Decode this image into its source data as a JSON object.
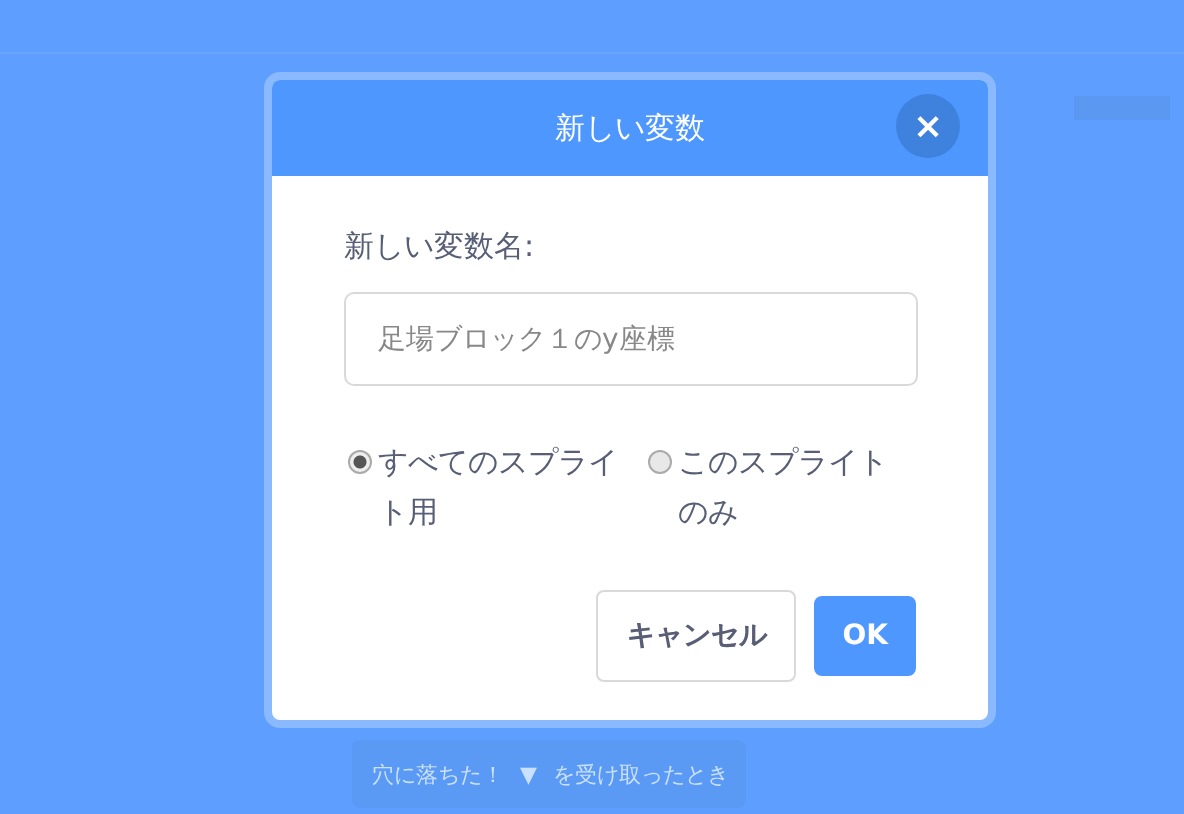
{
  "background_block": {
    "parts": [
      "穴に落ちた！",
      "▼",
      "を受け取ったとき"
    ]
  },
  "dialog": {
    "title": "新しい変数",
    "close": "×",
    "label": "新しい変数名:",
    "name_field": {
      "value": "足場ブロック１のy座標"
    },
    "scope_options": [
      {
        "label": "すべてのスプライト用",
        "selected": true
      },
      {
        "label": "このスプライトのみ",
        "selected": false
      }
    ],
    "buttons": [
      {
        "label": "キャンセル",
        "kind": "secondary"
      },
      {
        "label": "OK",
        "kind": "primary"
      }
    ]
  }
}
